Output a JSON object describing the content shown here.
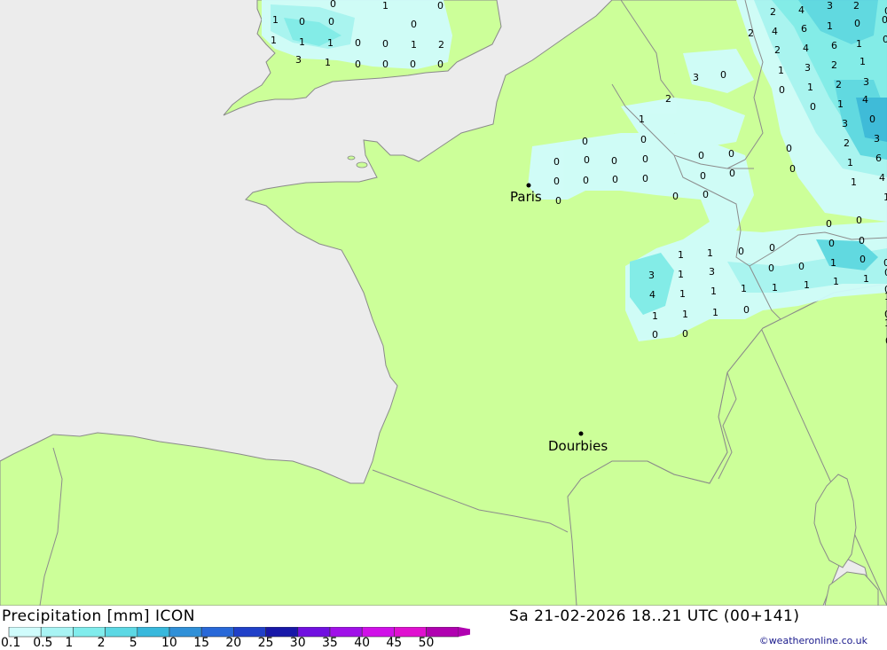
{
  "title": "Precipitation [mm] ICON",
  "valid_time": "Sa 21-02-2026 18..21 UTC (00+141)",
  "credit": "©weatheronline.co.uk",
  "colors": {
    "sea": "#ececec",
    "land": "#ccff99",
    "border": "#8c8c8c",
    "coast": "#8a8a8a"
  },
  "legend": {
    "labels": [
      "0.1",
      "0.5",
      "1",
      "2",
      "5",
      "10",
      "15",
      "20",
      "25",
      "30",
      "35",
      "40",
      "45",
      "50"
    ],
    "colors": [
      "#d0fcfc",
      "#a8f4f4",
      "#80ecec",
      "#5cd8e4",
      "#38b8dc",
      "#3090d8",
      "#2868d8",
      "#2040c8",
      "#1818a8",
      "#7010e0",
      "#a010e8",
      "#d010e8",
      "#e010d0",
      "#b000b0"
    ]
  },
  "cities": [
    {
      "name": "Paris"
    },
    {
      "name": "Dourbies"
    }
  ],
  "precip_labels": [
    "1",
    "0",
    "0",
    "1",
    "1",
    "1",
    "0",
    "0",
    "1",
    "2",
    "3",
    "1",
    "0",
    "0",
    "0",
    "0",
    "1",
    "0",
    "0",
    "0",
    "2",
    "4",
    "3",
    "2",
    "2",
    "4",
    "6",
    "1",
    "0",
    "0",
    "2",
    "4",
    "6",
    "1",
    "0",
    "1",
    "3",
    "2",
    "1",
    "0",
    "1",
    "2",
    "3",
    "0",
    "1",
    "4",
    "3",
    "0",
    "2",
    "3",
    "1",
    "6",
    "1",
    "4",
    "1",
    "3",
    "0",
    "2",
    "1",
    "0",
    "0",
    "0",
    "0",
    "0",
    "0",
    "0",
    "0",
    "0",
    "0",
    "0",
    "0",
    "0",
    "0",
    "0",
    "0",
    "0",
    "0",
    "0",
    "0",
    "0",
    "0",
    "0",
    "0",
    "0",
    "1",
    "0",
    "3",
    "1",
    "3",
    "4",
    "1",
    "1",
    "1",
    "1",
    "1",
    "1",
    "1",
    "1",
    "1",
    "1",
    "1",
    "1",
    "0",
    "0",
    "0",
    "0",
    "0",
    "0",
    "0",
    "0",
    "0",
    "0",
    "0",
    "1",
    "0",
    "1",
    "0"
  ]
}
